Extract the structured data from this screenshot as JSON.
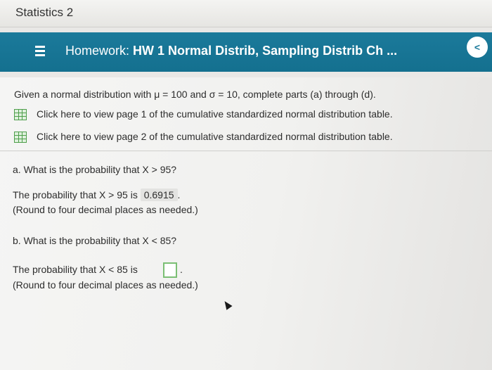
{
  "course": {
    "title": "Statistics 2"
  },
  "header": {
    "hw_prefix": "Homework:",
    "hw_title": "HW 1 Normal Distrib, Sampling Distrib Ch ...",
    "back_label": "<"
  },
  "problem": {
    "intro": "Given a normal distribution with μ = 100 and σ = 10, complete parts (a) through (d).",
    "link1": "Click here to view page 1 of the cumulative standardized normal distribution table.",
    "link2": "Click here to view page 2 of the cumulative standardized normal distribution table."
  },
  "part_a": {
    "question": "a. What is the probability that X > 95?",
    "answer_prefix": "The probability that X > 95 is",
    "answer_value": "0.6915",
    "answer_suffix": ".",
    "note": "(Round to four decimal places as needed.)"
  },
  "part_b": {
    "question": "b. What is the probability that X < 85?",
    "answer_prefix": "The probability that X < 85 is",
    "answer_value": "",
    "answer_suffix": ".",
    "note": "(Round to four decimal places as needed.)"
  }
}
